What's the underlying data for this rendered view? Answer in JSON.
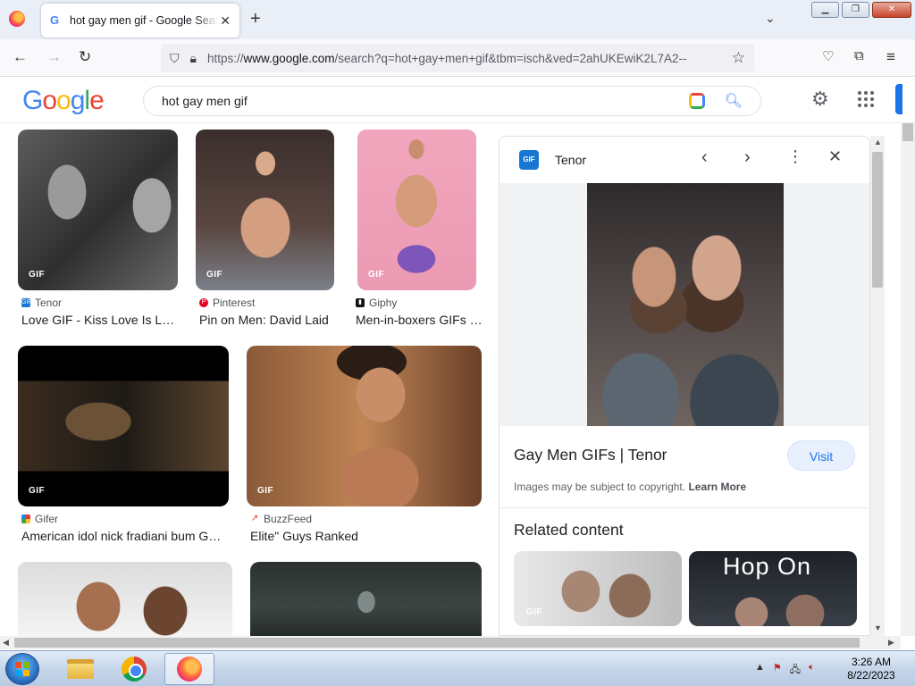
{
  "browser": {
    "tab_title": "hot gay men gif - Google Search",
    "url_host": "www.google.com",
    "url_prefix": "https://",
    "url_path": "/search?q=hot+gay+men+gif&tbm=isch&ved=2ahUKEwiK2L7A2--",
    "new_tab": "+",
    "tab_close": "✕"
  },
  "google": {
    "logo": [
      "G",
      "o",
      "o",
      "g",
      "l",
      "e"
    ],
    "query": "hot gay men gif"
  },
  "results": [
    {
      "source": "Tenor",
      "caption": "Love GIF - Kiss Love Is L…",
      "badge": "GIF",
      "fav_color": "#1976d2"
    },
    {
      "source": "Pinterest",
      "caption": "Pin on Men: David Laid",
      "badge": "GIF",
      "fav_color": "#e60023"
    },
    {
      "source": "Giphy",
      "caption": "Men-in-boxers GIFs …",
      "badge": "GIF",
      "fav_color": "#111111"
    },
    {
      "source": "Gifer",
      "caption": "American idol nick fradiani bum G…",
      "badge": "GIF",
      "fav_color": "#7cb342"
    },
    {
      "source": "BuzzFeed",
      "caption": "Elite\" Guys Ranked",
      "badge": "GIF",
      "fav_color": "#ee3322"
    }
  ],
  "panel": {
    "source": "Tenor",
    "source_icon_text": "GIF",
    "title": "Gay Men GIFs | Tenor",
    "visit_label": "Visit",
    "copyright": "Images may be subject to copyright.",
    "learn_more": "Learn More",
    "related_heading": "Related content",
    "related_badge": "GIF",
    "related_overlay": "Hop On"
  },
  "taskbar": {
    "time": "3:26 AM",
    "date": "8/22/2023"
  }
}
